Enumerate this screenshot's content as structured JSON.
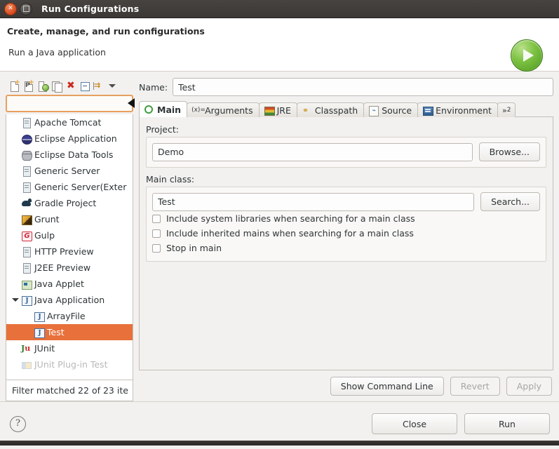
{
  "window": {
    "title": "Run Configurations",
    "close_icon": "close-icon",
    "maximize_icon": "maximize-icon"
  },
  "header": {
    "title": "Create, manage, and run configurations",
    "subtitle": "Run a Java application",
    "badge_icon": "run-play-icon"
  },
  "toolbar": {
    "items": [
      {
        "name": "new-configuration-button",
        "icon": "new-document-icon"
      },
      {
        "name": "new-prototype-button",
        "icon": "new-prototype-icon"
      },
      {
        "name": "export-button",
        "icon": "export-icon"
      },
      {
        "name": "duplicate-button",
        "icon": "duplicate-icon"
      },
      {
        "name": "delete-button",
        "icon": "delete-x-icon"
      },
      {
        "name": "collapse-all-button",
        "icon": "collapse-all-icon"
      },
      {
        "name": "filter-button",
        "icon": "filter-arrows-icon"
      },
      {
        "name": "view-menu-button",
        "icon": "chevron-down-icon"
      }
    ]
  },
  "filter": {
    "value": "",
    "placeholder": "",
    "status": "Filter matched 22 of 23 ite"
  },
  "tree": {
    "items": [
      {
        "label": "Apache Tomcat",
        "icon": "server-icon",
        "level": 0,
        "selected": false,
        "expandable": false
      },
      {
        "label": "Eclipse Application",
        "icon": "eclipse-icon",
        "level": 0,
        "selected": false,
        "expandable": false
      },
      {
        "label": "Eclipse Data Tools",
        "icon": "database-icon",
        "level": 0,
        "selected": false,
        "expandable": false
      },
      {
        "label": "Generic Server",
        "icon": "server-icon",
        "level": 0,
        "selected": false,
        "expandable": false
      },
      {
        "label": "Generic Server(Exter",
        "icon": "server-icon",
        "level": 0,
        "selected": false,
        "expandable": false
      },
      {
        "label": "Gradle Project",
        "icon": "gradle-icon",
        "level": 0,
        "selected": false,
        "expandable": false
      },
      {
        "label": "Grunt",
        "icon": "grunt-icon",
        "level": 0,
        "selected": false,
        "expandable": false
      },
      {
        "label": "Gulp",
        "icon": "gulp-icon",
        "level": 0,
        "selected": false,
        "expandable": false
      },
      {
        "label": "HTTP Preview",
        "icon": "server-icon",
        "level": 0,
        "selected": false,
        "expandable": false
      },
      {
        "label": "J2EE Preview",
        "icon": "server-icon",
        "level": 0,
        "selected": false,
        "expandable": false
      },
      {
        "label": "Java Applet",
        "icon": "java-applet-icon",
        "level": 0,
        "selected": false,
        "expandable": false
      },
      {
        "label": "Java Application",
        "icon": "java-icon",
        "level": 0,
        "selected": false,
        "expandable": true
      },
      {
        "label": "ArrayFile",
        "icon": "java-icon",
        "level": 1,
        "selected": false,
        "expandable": false
      },
      {
        "label": "Test",
        "icon": "java-icon",
        "level": 1,
        "selected": true,
        "expandable": false
      },
      {
        "label": "JUnit",
        "icon": "junit-icon",
        "level": 0,
        "selected": false,
        "expandable": false
      },
      {
        "label": "JUnit Plug-in Test",
        "icon": "junit-plugin-icon",
        "level": 0,
        "selected": false,
        "expandable": false,
        "clipped": true
      }
    ]
  },
  "config": {
    "name_label": "Name:",
    "name_value": "Test",
    "tabs": [
      {
        "label": "Main",
        "icon": "main-tab-icon",
        "active": true
      },
      {
        "label": "Arguments",
        "icon": "arguments-tab-icon",
        "active": false
      },
      {
        "label": "JRE",
        "icon": "jre-tab-icon",
        "active": false
      },
      {
        "label": "Classpath",
        "icon": "classpath-tab-icon",
        "active": false
      },
      {
        "label": "Source",
        "icon": "source-tab-icon",
        "active": false
      },
      {
        "label": "Environment",
        "icon": "environment-tab-icon",
        "active": false
      }
    ],
    "tab_overflow": "»",
    "tab_overflow_count": "2",
    "project": {
      "legend": "Project:",
      "value": "Demo",
      "browse_label": "Browse..."
    },
    "main_class": {
      "legend": "Main class:",
      "value": "Test",
      "search_label": "Search..."
    },
    "checkboxes": [
      {
        "label": "Include system libraries when searching for a main class",
        "checked": false
      },
      {
        "label": "Include inherited mains when searching for a main class",
        "checked": false
      },
      {
        "label": "Stop in main",
        "checked": false
      }
    ],
    "actions": {
      "show_command_line": "Show Command Line",
      "revert": "Revert",
      "apply": "Apply"
    }
  },
  "footer": {
    "help_icon": "help-icon",
    "help_glyph": "?",
    "close_label": "Close",
    "run_label": "Run"
  },
  "colors": {
    "selection": "#e8703a",
    "titlebar": "#3c3836",
    "accent_green": "#7dc242",
    "focus_border": "#e8a060"
  }
}
